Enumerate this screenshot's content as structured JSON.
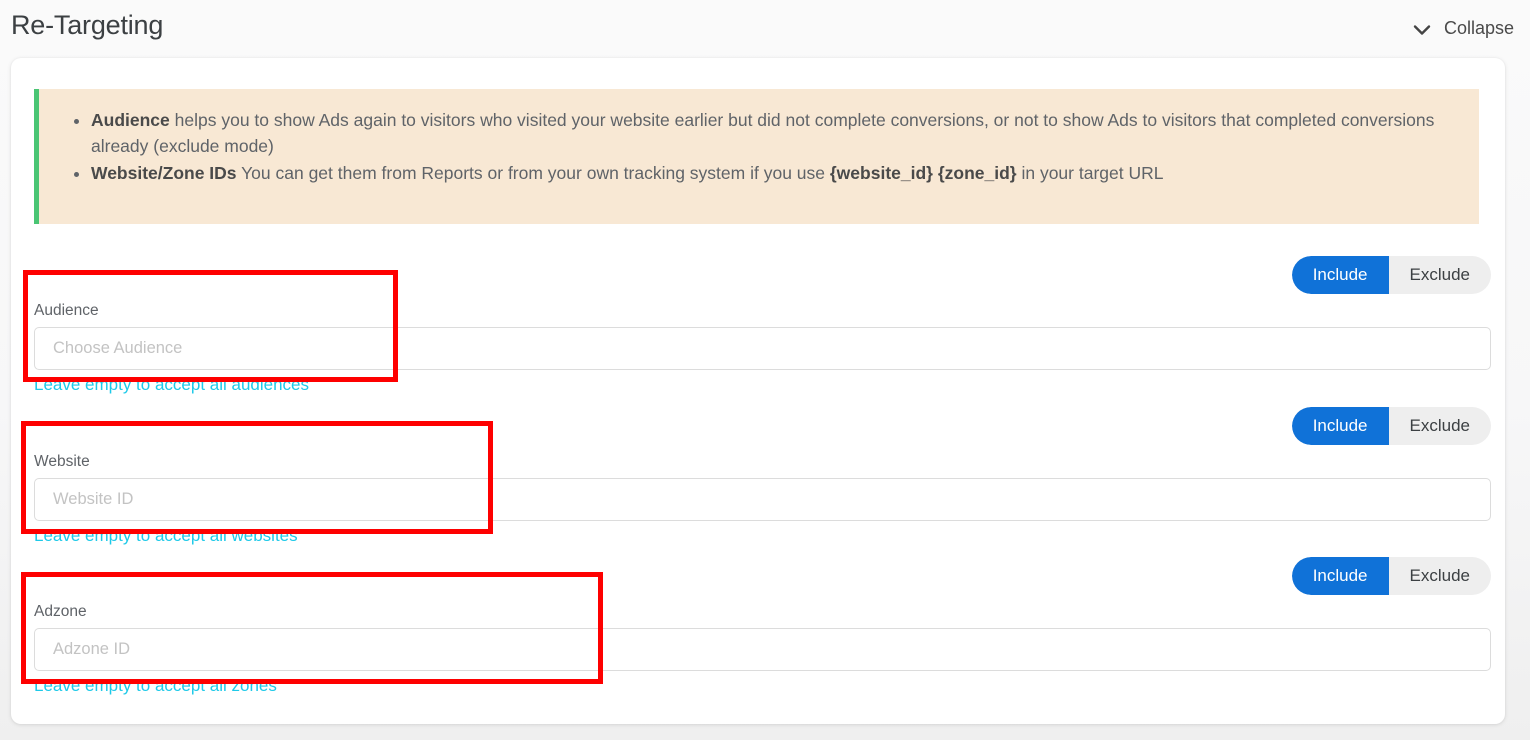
{
  "header": {
    "title": "Re-Targeting",
    "collapse_label": "Collapse",
    "chevron_icon": "chevron-down-icon"
  },
  "info_banner": {
    "accent_color": "#4ac574",
    "background_color": "#f8e8d4",
    "bullets": [
      {
        "bold": "Audience",
        "text": " helps you to show Ads again to visitors who visited your website earlier but did not complete conversions, or not to show Ads to visitors that completed conversions already (exclude mode)"
      },
      {
        "bold": "Website/Zone IDs",
        "text_before": " You can get them from Reports or from your own tracking system if you use ",
        "bold2": "{website_id} {zone_id}",
        "text_after": " in your target URL"
      }
    ]
  },
  "toggle": {
    "include_label": "Include",
    "exclude_label": "Exclude",
    "active": "Include",
    "active_color": "#1072d8",
    "track_color": "#eeeeee"
  },
  "fields": [
    {
      "id": "audience",
      "label": "Audience",
      "placeholder": "Choose Audience",
      "value": "",
      "hint": "Leave empty to accept all audiences",
      "hint_color": "#1ec9e8"
    },
    {
      "id": "website",
      "label": "Website",
      "placeholder": "Website ID",
      "value": "",
      "hint": "Leave empty to accept all websites",
      "hint_color": "#1ec9e8"
    },
    {
      "id": "adzone",
      "label": "Adzone",
      "placeholder": "Adzone ID",
      "value": "",
      "hint": "Leave empty to accept all zones",
      "hint_color": "#1ec9e8"
    }
  ],
  "annotations": {
    "color": "#fe0000",
    "boxes": [
      "audience-field-group",
      "website-field-group",
      "adzone-field-group"
    ]
  }
}
